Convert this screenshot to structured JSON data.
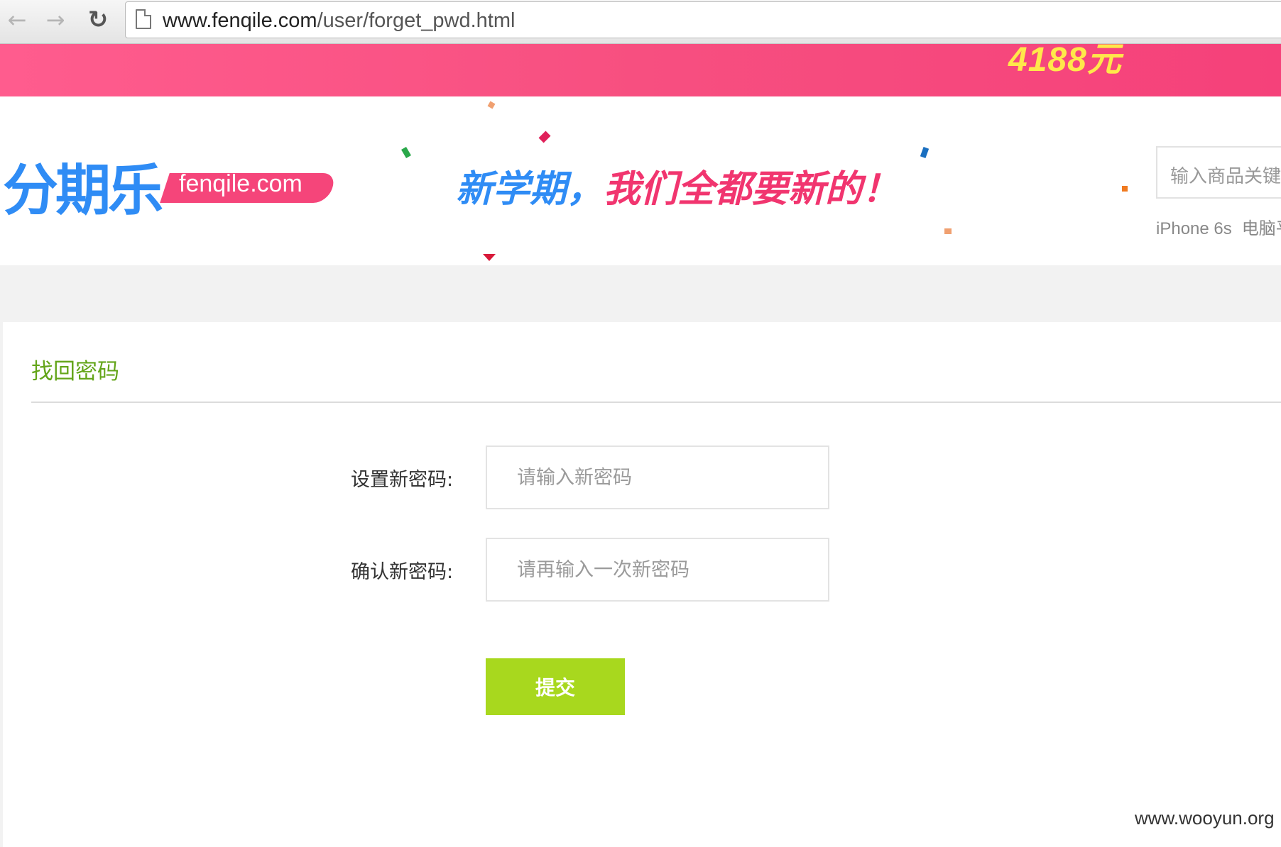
{
  "browser": {
    "url_host": "www.fenqile.com",
    "url_path": "/user/forget_pwd.html",
    "back_icon": "arrow-left-icon",
    "forward_icon": "arrow-right-icon",
    "reload_icon": "reload-icon"
  },
  "promo": {
    "price_text": "4188元"
  },
  "header": {
    "logo_cn": "分期乐",
    "logo_en": "fenqile.com",
    "slogan_part1": "新学期，",
    "slogan_part2": "我们全都要新的！",
    "search_placeholder": "输入商品关键",
    "hot_links": [
      "iPhone 6s",
      "电脑平"
    ]
  },
  "form": {
    "title": "找回密码",
    "new_password_label": "设置新密码:",
    "new_password_placeholder": "请输入新密码",
    "confirm_password_label": "确认新密码:",
    "confirm_password_placeholder": "请再输入一次新密码",
    "submit_label": "提交"
  },
  "watermark": "www.wooyun.org",
  "colors": {
    "brand_blue": "#2f8cf5",
    "brand_pink": "#f5457a",
    "title_green": "#64a51a",
    "submit_green": "#a8d81e"
  }
}
